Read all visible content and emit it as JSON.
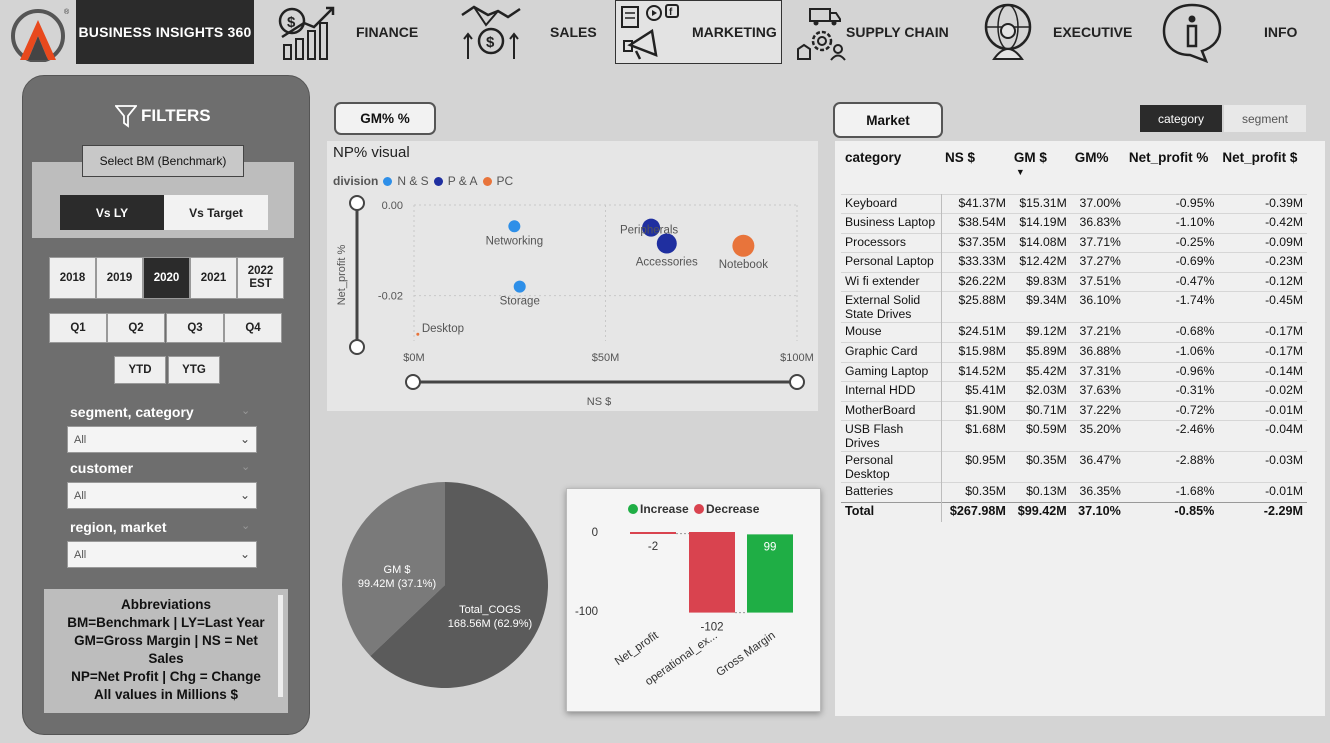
{
  "app": {
    "brand": "BUSINESS INSIGHTS 360"
  },
  "nav": [
    {
      "label": "FINANCE",
      "icon": "finance-chart-icon",
      "active": false
    },
    {
      "label": "SALES",
      "icon": "sales-handshake-icon",
      "active": false
    },
    {
      "label": "MARKETING",
      "icon": "marketing-megaphone-icon",
      "active": true
    },
    {
      "label": "SUPPLY CHAIN",
      "icon": "supply-chain-truck-icon",
      "active": false
    },
    {
      "label": "EXECUTIVE",
      "icon": "executive-globe-icon",
      "active": false
    },
    {
      "label": "INFO",
      "icon": "info-icon",
      "active": false
    }
  ],
  "filters": {
    "title": "FILTERS",
    "benchmark_label": "Select BM (Benchmark)",
    "vs_ly": "Vs LY",
    "vs_target": "Vs Target",
    "years": [
      "2018",
      "2019",
      "2020",
      "2021",
      "2022 EST"
    ],
    "selected_year": "2020",
    "quarters": [
      "Q1",
      "Q2",
      "Q3",
      "Q4"
    ],
    "ytd": "YTD",
    "ytg": "YTG",
    "segment_label": "segment, category",
    "segment_value": "All",
    "customer_label": "customer",
    "customer_value": "All",
    "region_label": "region, market",
    "region_value": "All",
    "abbreviations": [
      "Abbreviations",
      "BM=Benchmark | LY=Last Year",
      "GM=Gross Margin | NS = Net",
      "Sales",
      "NP=Net Profit | Chg = Change",
      "All values in Millions $"
    ]
  },
  "gm_button": "GM% %",
  "market_button": "Market",
  "table_tabs": {
    "category": "category",
    "segment": "segment"
  },
  "scatter": {
    "title": "NP% visual",
    "legend_title": "division",
    "legend": [
      {
        "name": "N & S",
        "color": "#2e8fe8"
      },
      {
        "name": "P & A",
        "color": "#1f2fa0"
      },
      {
        "name": "PC",
        "color": "#e8743b"
      }
    ]
  },
  "chart_data": [
    {
      "type": "scatter",
      "title": "NP% visual",
      "xlabel": "NS $",
      "ylabel": "Net_profit %",
      "x_ticks": [
        "$0M",
        "$50M",
        "$100M"
      ],
      "y_ticks": [
        "0.00",
        "-0.02"
      ],
      "xlim": [
        0,
        100
      ],
      "ylim": [
        -0.03,
        0.0
      ],
      "series": [
        {
          "name": "N & S",
          "color": "#2e8fe8",
          "points": [
            {
              "label": "Networking",
              "x": 26.2,
              "y": -0.0047
            },
            {
              "label": "Storage",
              "x": 27.6,
              "y": -0.018
            }
          ]
        },
        {
          "name": "P & A",
          "color": "#1f2fa0",
          "points": [
            {
              "label": "Peripherals",
              "x": 61.9,
              "y": -0.005
            },
            {
              "label": "Accessories",
              "x": 66.0,
              "y": -0.0085
            }
          ]
        },
        {
          "name": "PC",
          "color": "#e8743b",
          "points": [
            {
              "label": "Notebook",
              "x": 86.0,
              "y": -0.009
            },
            {
              "label": "Desktop",
              "x": 1.0,
              "y": -0.0285
            }
          ]
        }
      ]
    },
    {
      "type": "pie",
      "slices": [
        {
          "name": "GM $",
          "value": 99.42,
          "label": "99.42M (37.1%)",
          "color": "#7a7a7a"
        },
        {
          "name": "Total_COGS",
          "value": 168.56,
          "label": "168.56M (62.9%)",
          "color": "#5b5b5b"
        }
      ]
    },
    {
      "type": "bar",
      "subtype": "waterfall",
      "legend": [
        {
          "name": "Increase",
          "color": "#1fae45"
        },
        {
          "name": "Decrease",
          "color": "#d9434f"
        }
      ],
      "categories": [
        "Net_profit",
        "operational_ex...",
        "Gross Margin"
      ],
      "values": [
        -2,
        -102,
        99
      ],
      "y_ticks": [
        "0",
        "-100"
      ],
      "ylim": [
        -115,
        5
      ]
    }
  ],
  "table": {
    "headers": [
      "category",
      "NS $",
      "GM $",
      "GM%",
      "Net_profit %",
      "Net_profit $"
    ],
    "rows": [
      [
        "Keyboard",
        "$41.37M",
        "$15.31M",
        "37.00%",
        "-0.95%",
        "-0.39M"
      ],
      [
        "Business Laptop",
        "$38.54M",
        "$14.19M",
        "36.83%",
        "-1.10%",
        "-0.42M"
      ],
      [
        "Processors",
        "$37.35M",
        "$14.08M",
        "37.71%",
        "-0.25%",
        "-0.09M"
      ],
      [
        "Personal Laptop",
        "$33.33M",
        "$12.42M",
        "37.27%",
        "-0.69%",
        "-0.23M"
      ],
      [
        "Wi fi extender",
        "$26.22M",
        "$9.83M",
        "37.51%",
        "-0.47%",
        "-0.12M"
      ],
      [
        "External Solid State Drives",
        "$25.88M",
        "$9.34M",
        "36.10%",
        "-1.74%",
        "-0.45M"
      ],
      [
        "Mouse",
        "$24.51M",
        "$9.12M",
        "37.21%",
        "-0.68%",
        "-0.17M"
      ],
      [
        "Graphic Card",
        "$15.98M",
        "$5.89M",
        "36.88%",
        "-1.06%",
        "-0.17M"
      ],
      [
        "Gaming Laptop",
        "$14.52M",
        "$5.42M",
        "37.31%",
        "-0.96%",
        "-0.14M"
      ],
      [
        "Internal HDD",
        "$5.41M",
        "$2.03M",
        "37.63%",
        "-0.31%",
        "-0.02M"
      ],
      [
        "MotherBoard",
        "$1.90M",
        "$0.71M",
        "37.22%",
        "-0.72%",
        "-0.01M"
      ],
      [
        "USB Flash Drives",
        "$1.68M",
        "$0.59M",
        "35.20%",
        "-2.46%",
        "-0.04M"
      ],
      [
        "Personal Desktop",
        "$0.95M",
        "$0.35M",
        "36.47%",
        "-2.88%",
        "-0.03M"
      ],
      [
        "Batteries",
        "$0.35M",
        "$0.13M",
        "36.35%",
        "-1.68%",
        "-0.01M"
      ]
    ],
    "total": [
      "Total",
      "$267.98M",
      "$99.42M",
      "37.10%",
      "-0.85%",
      "-2.29M"
    ]
  }
}
